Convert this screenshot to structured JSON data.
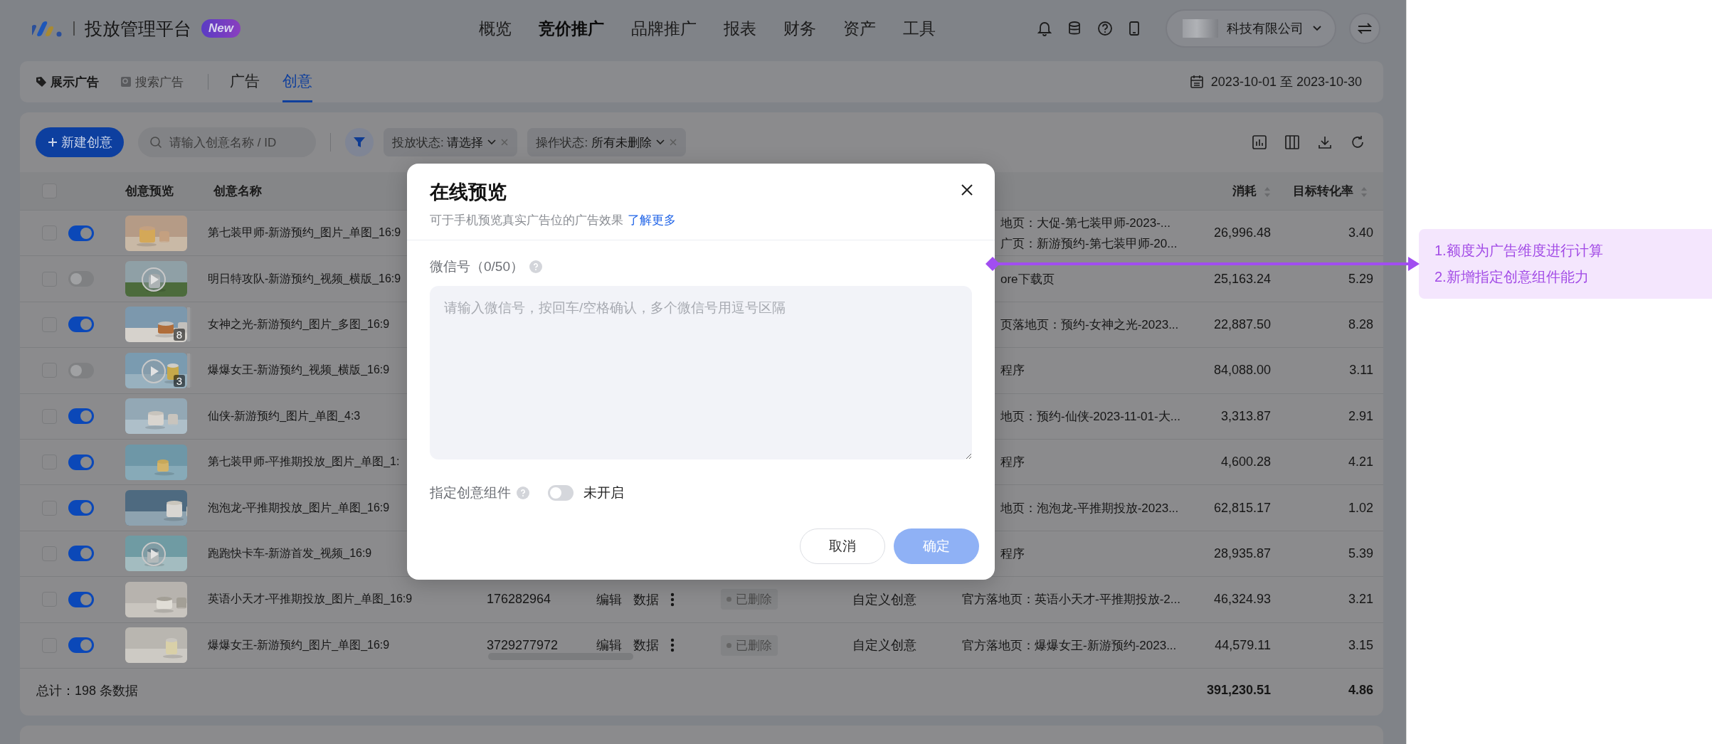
{
  "header": {
    "brand": "投放管理平台",
    "badge": "New",
    "nav": [
      {
        "label": "概览",
        "selected": false
      },
      {
        "label": "竞价推广",
        "selected": true
      },
      {
        "label": "品牌推广",
        "selected": false
      },
      {
        "label": "报表",
        "selected": false
      },
      {
        "label": "财务",
        "selected": false
      },
      {
        "label": "资产",
        "selected": false
      },
      {
        "label": "工具",
        "selected": false
      }
    ],
    "account": "科技有限公司"
  },
  "subbar": {
    "ad_types": [
      {
        "label": "展示广告",
        "selected": true
      },
      {
        "label": "搜索广告",
        "selected": false
      }
    ],
    "tabs": [
      {
        "label": "广告",
        "selected": false
      },
      {
        "label": "创意",
        "selected": true
      }
    ],
    "date_range": "2023-10-01 至 2023-10-30"
  },
  "toolbar": {
    "new_button": "新建创意",
    "search": {
      "placeholder": "请输入创意名称 / ID"
    },
    "filters": [
      {
        "label": "投放状态: ",
        "value": "请选择"
      },
      {
        "label": "操作状态: ",
        "value": "所有未删除"
      }
    ]
  },
  "table": {
    "select_all": {
      "checked": false
    },
    "columns": [
      {
        "label": "创意预览"
      },
      {
        "label": "创意名称"
      },
      {
        "label": "消耗",
        "sortable": true
      },
      {
        "label": "目标转化率",
        "sortable": true
      }
    ],
    "rows": [
      {
        "checked": false,
        "on": true,
        "preview": {
          "kind": "picture",
          "video": false
        },
        "name": "第七装甲师-新游预约_图片_单图_16:9",
        "landing": [
          "地页：大促-第七装甲师-2023-...",
          "广页：新游预约-第七装甲师-20..."
        ],
        "spend": "26,996.48",
        "rate": "3.40"
      },
      {
        "checked": false,
        "on": false,
        "preview": {
          "kind": "picture",
          "video": true
        },
        "name": "明日特攻队-新游预约_视频_横版_16:9",
        "landing": [
          "ore下载页"
        ],
        "spend": "25,163.24",
        "rate": "5.29"
      },
      {
        "checked": false,
        "on": true,
        "preview": {
          "kind": "picture",
          "video": false,
          "count": "8"
        },
        "name": "女神之光-新游预约_图片_多图_16:9",
        "landing": [
          "页落地页：预约-女神之光-2023..."
        ],
        "spend": "22,887.50",
        "rate": "8.28"
      },
      {
        "checked": false,
        "on": false,
        "preview": {
          "kind": "picture",
          "video": true,
          "count": "3"
        },
        "name": "爆爆女王-新游预约_视频_横版_16:9",
        "landing": [
          "程序"
        ],
        "spend": "84,088.00",
        "rate": "3.11"
      },
      {
        "checked": false,
        "on": true,
        "preview": {
          "kind": "picture",
          "video": false
        },
        "name": "仙侠-新游预约_图片_单图_4:3",
        "landing": [
          "地页：预约-仙侠-2023-11-01-大..."
        ],
        "spend": "3,313.87",
        "rate": "2.91"
      },
      {
        "checked": false,
        "on": true,
        "preview": {
          "kind": "picture",
          "video": false
        },
        "name": "第七装甲师-平推期投放_图片_单图_1:",
        "landing": [
          "程序"
        ],
        "spend": "4,600.28",
        "rate": "4.21"
      },
      {
        "checked": false,
        "on": true,
        "preview": {
          "kind": "picture",
          "video": false
        },
        "name": "泡泡龙-平推期投放_图片_单图_16:9",
        "landing": [
          "地页：泡泡龙-平推期投放-2023..."
        ],
        "spend": "62,815.17",
        "rate": "1.02"
      },
      {
        "checked": false,
        "on": true,
        "preview": {
          "kind": "picture",
          "video": true
        },
        "name": "跑跑快卡车-新游首发_视频_16:9",
        "landing": [
          "程序"
        ],
        "spend": "28,935.87",
        "rate": "5.39"
      },
      {
        "checked": false,
        "on": true,
        "preview": {
          "kind": "picture",
          "video": false
        },
        "name": "英语小天才-平推期投放_图片_单图_16:9",
        "id": "176282964",
        "actions": [
          "编辑",
          "数据"
        ],
        "status": "已删除",
        "type": "自定义创意",
        "landing": [
          "官方落地页：英语小天才-平推期投放-2..."
        ],
        "spend": "46,324.93",
        "rate": "3.21"
      },
      {
        "checked": false,
        "on": true,
        "preview": {
          "kind": "picture",
          "video": false
        },
        "name": "爆爆女王-新游预约_图片_单图_16:9",
        "id": "3729277972",
        "actions": [
          "编辑",
          "数据"
        ],
        "status": "已删除",
        "type": "自定义创意",
        "landing": [
          "官方落地页：爆爆女王-新游预约-2023..."
        ],
        "spend": "44,579.11",
        "rate": "3.15"
      }
    ],
    "total": {
      "label": "总计：198 条数据",
      "spend": "391,230.51",
      "rate": "4.86"
    }
  },
  "modal": {
    "title": "在线预览",
    "subtitle": "可于手机预览真实广告位的广告效果",
    "link": "了解更多",
    "field_label": "微信号（0/50）",
    "placeholder": "请输入微信号，按回车/空格确认，多个微信号用逗号区隔",
    "option_label": "指定创意组件",
    "option_on": false,
    "option_state": "未开启",
    "buttons": [
      {
        "label": "取消",
        "kind": "secondary",
        "disabled": false
      },
      {
        "label": "确定",
        "kind": "primary",
        "disabled": true
      }
    ]
  },
  "note": {
    "lines": [
      "1.额度为广告维度进行计算",
      "2.新增指定创意组件能力"
    ]
  }
}
